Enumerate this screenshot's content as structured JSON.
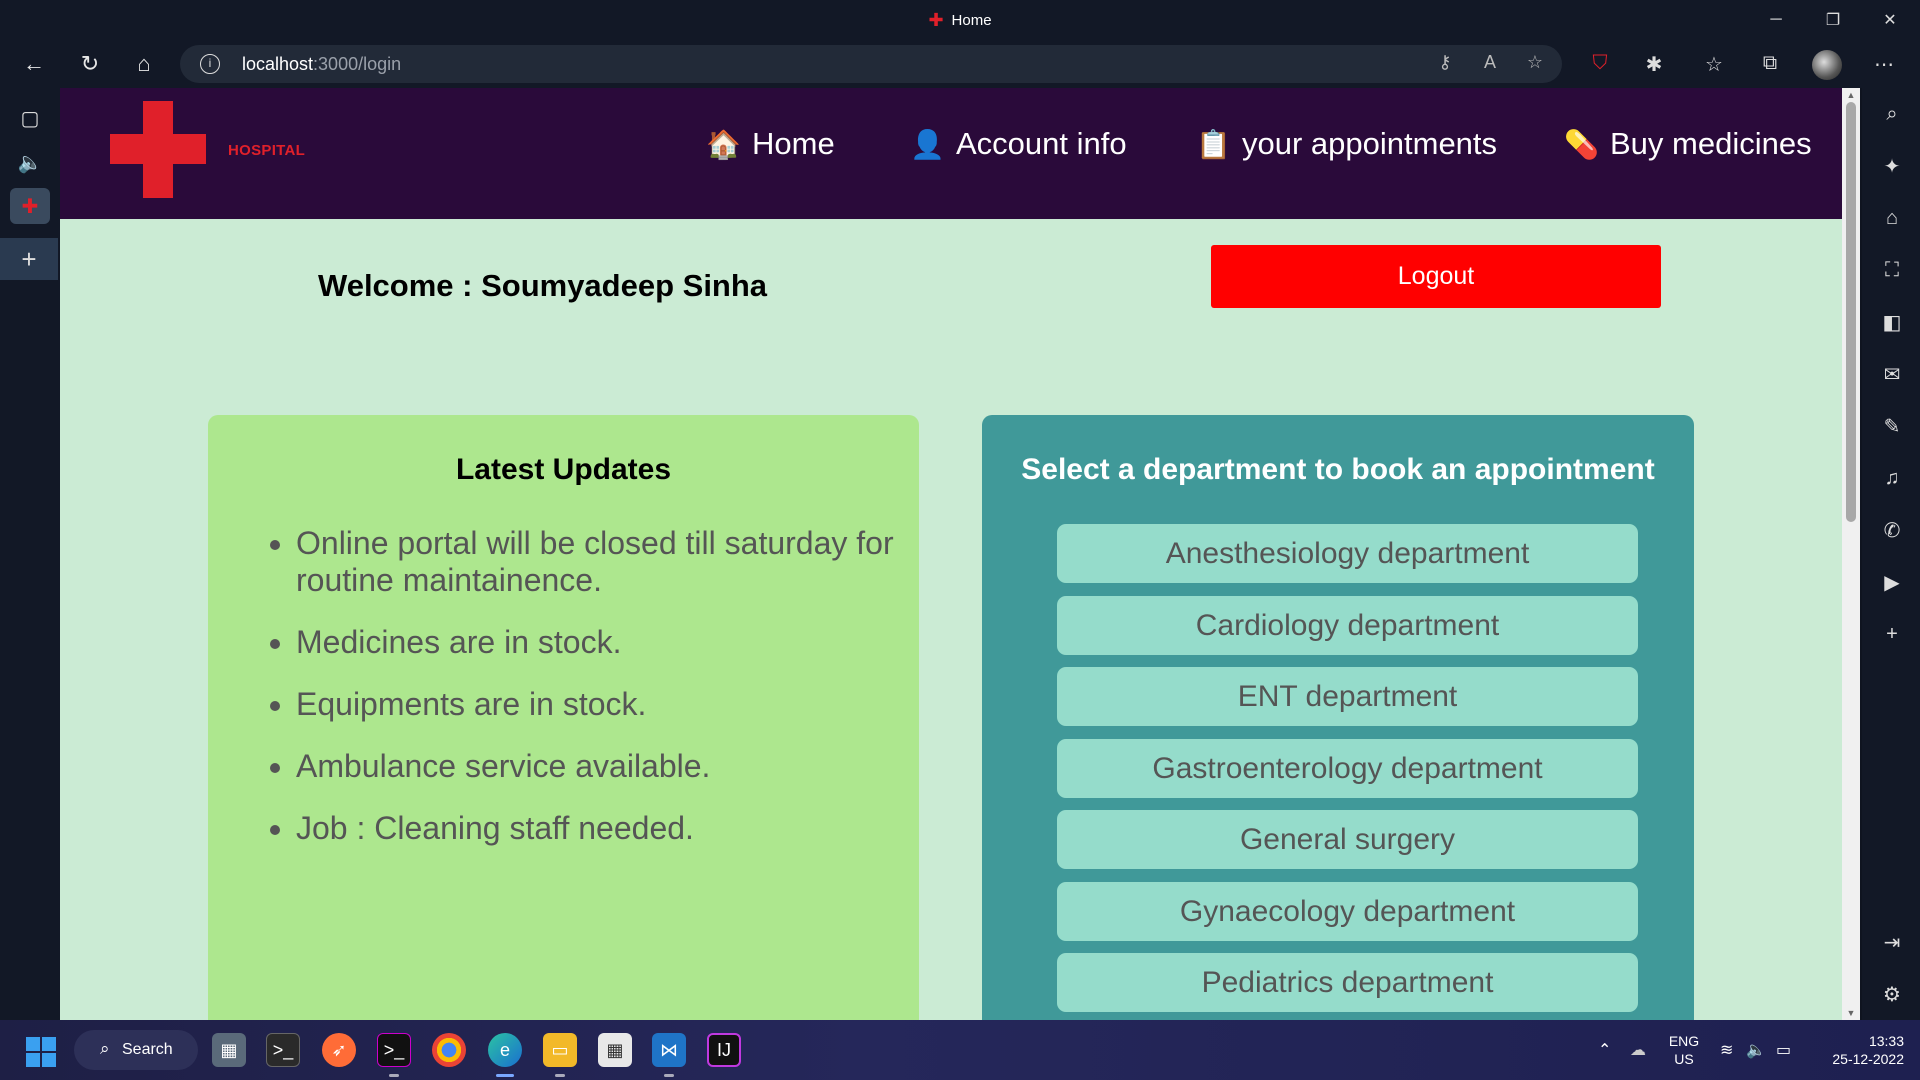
{
  "window": {
    "title": "Home"
  },
  "browser": {
    "url_host": "localhost",
    "url_path": ":3000/login",
    "profile_badge_count": "1"
  },
  "site": {
    "logo_text": "HOSPITAL",
    "menu": [
      {
        "label": "Home",
        "icon": "house-icon"
      },
      {
        "label": "Account info",
        "icon": "person-icon"
      },
      {
        "label": "your appointments",
        "icon": "clipboard-icon"
      },
      {
        "label": "Buy medicines",
        "icon": "pill-icon"
      }
    ]
  },
  "main": {
    "welcome_text": "Welcome : Soumyadeep Sinha",
    "logout_label": "Logout",
    "updates": {
      "heading": "Latest Updates",
      "items": [
        "Online portal will be closed till saturday for routine maintainence.",
        "Medicines are in stock.",
        "Equipments are in stock.",
        "Ambulance service available.",
        "Job : Cleaning staff needed."
      ]
    },
    "departments": {
      "heading": "Select a department to book an appointment",
      "items": [
        "Anesthesiology department",
        "Cardiology department",
        "ENT department",
        "Gastroenterology department",
        "General surgery",
        "Gynaecology department",
        "Pediatrics department"
      ]
    }
  },
  "taskbar": {
    "search_label": "Search",
    "language": "ENG",
    "region": "US",
    "time": "13:33",
    "date": "25-12-2022"
  },
  "colors": {
    "header_bg": "#2a0a3a",
    "page_bg": "#cbebd4",
    "logo_red": "#e0202a",
    "logout_red": "#ff0000",
    "updates_bg": "#ade78e",
    "dept_panel_bg": "#409999",
    "dept_button_bg": "#95dccb"
  }
}
